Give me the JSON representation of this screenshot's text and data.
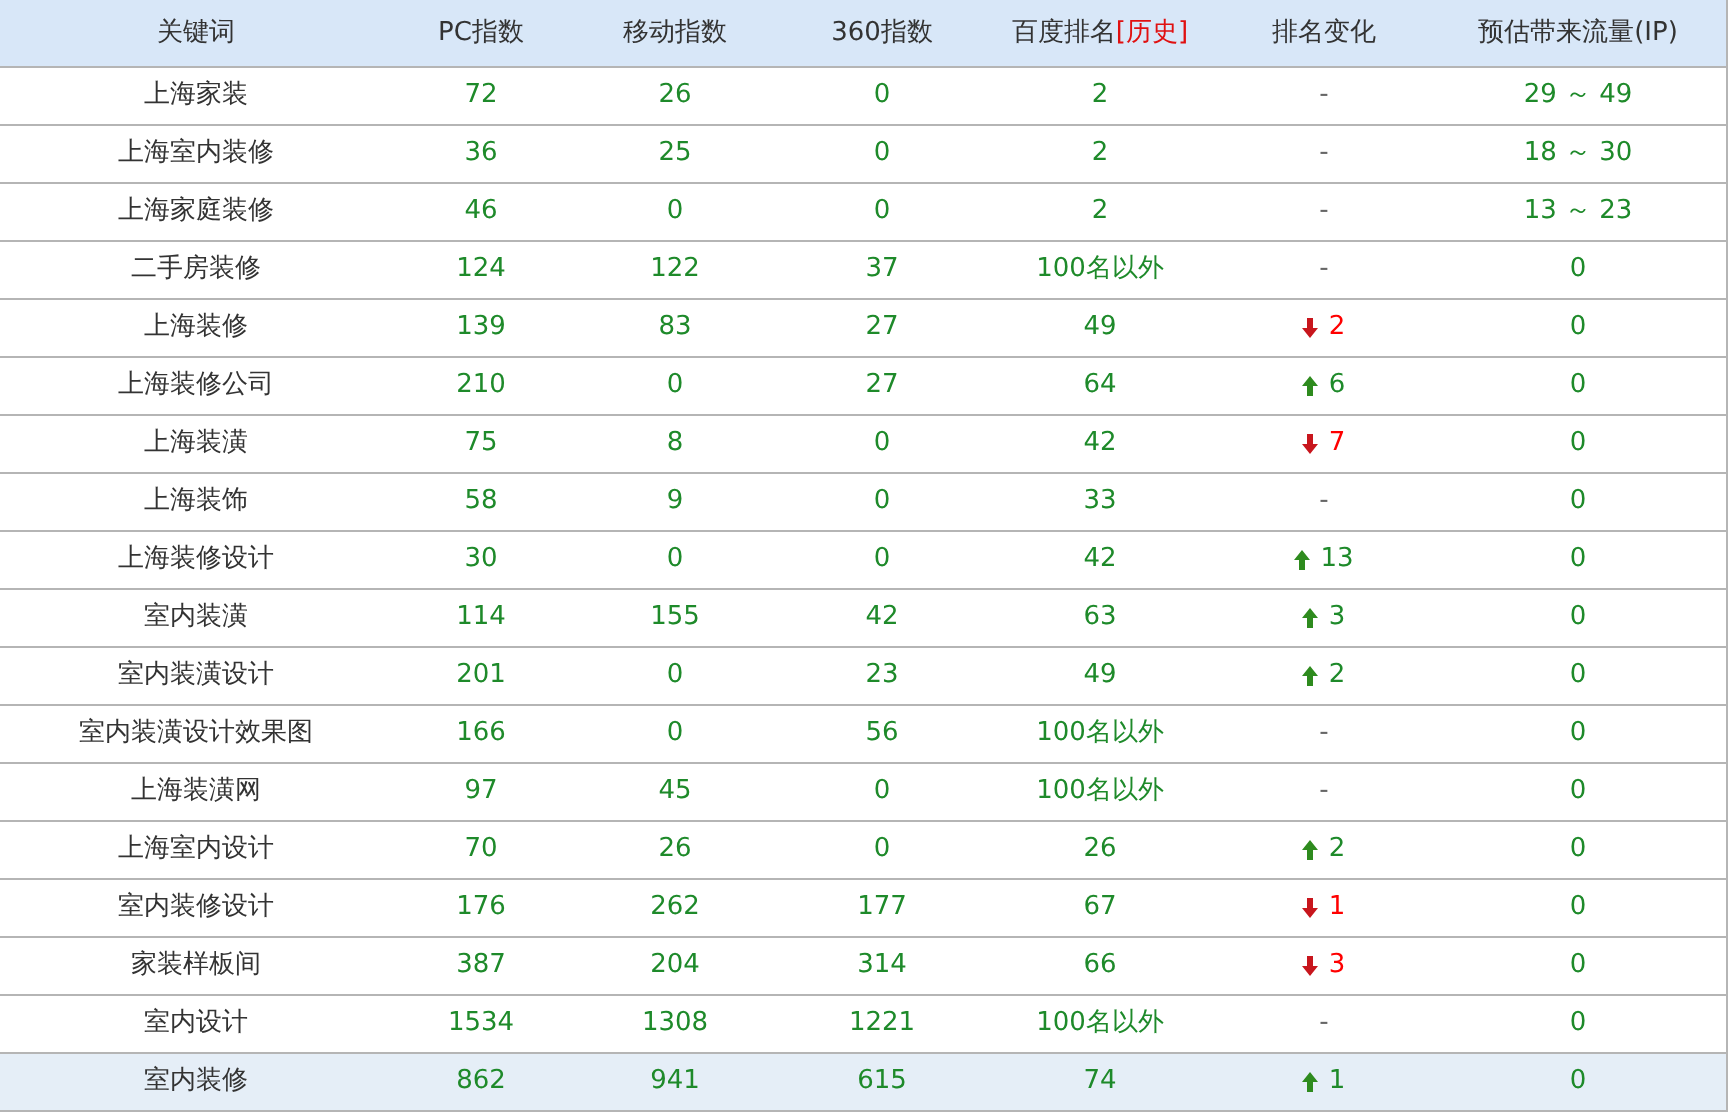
{
  "table": {
    "columns": [
      {
        "label": "关键词"
      },
      {
        "label": "PC指数"
      },
      {
        "label": "移动指数"
      },
      {
        "label": "360指数"
      },
      {
        "label": "百度排名",
        "link": "[历史]"
      },
      {
        "label": "排名变化"
      },
      {
        "label": "预估带来流量(IP)"
      }
    ],
    "rows": [
      {
        "keyword": "上海家装",
        "pc": "72",
        "mobile": "26",
        "index360": "0",
        "rank": "2",
        "change": {
          "kind": "none",
          "text": "-"
        },
        "traffic": "29 ～ 49",
        "selected": false
      },
      {
        "keyword": "上海室内装修",
        "pc": "36",
        "mobile": "25",
        "index360": "0",
        "rank": "2",
        "change": {
          "kind": "none",
          "text": "-"
        },
        "traffic": "18 ～ 30",
        "selected": false
      },
      {
        "keyword": "上海家庭装修",
        "pc": "46",
        "mobile": "0",
        "index360": "0",
        "rank": "2",
        "change": {
          "kind": "none",
          "text": "-"
        },
        "traffic": "13 ～ 23",
        "selected": false
      },
      {
        "keyword": "二手房装修",
        "pc": "124",
        "mobile": "122",
        "index360": "37",
        "rank": "100名以外",
        "change": {
          "kind": "none",
          "text": "-"
        },
        "traffic": "0",
        "selected": false
      },
      {
        "keyword": "上海装修",
        "pc": "139",
        "mobile": "83",
        "index360": "27",
        "rank": "49",
        "change": {
          "kind": "down",
          "text": "2"
        },
        "traffic": "0",
        "selected": false
      },
      {
        "keyword": "上海装修公司",
        "pc": "210",
        "mobile": "0",
        "index360": "27",
        "rank": "64",
        "change": {
          "kind": "up",
          "text": "6"
        },
        "traffic": "0",
        "selected": false
      },
      {
        "keyword": "上海装潢",
        "pc": "75",
        "mobile": "8",
        "index360": "0",
        "rank": "42",
        "change": {
          "kind": "down",
          "text": "7"
        },
        "traffic": "0",
        "selected": false
      },
      {
        "keyword": "上海装饰",
        "pc": "58",
        "mobile": "9",
        "index360": "0",
        "rank": "33",
        "change": {
          "kind": "none",
          "text": "-"
        },
        "traffic": "0",
        "selected": false
      },
      {
        "keyword": "上海装修设计",
        "pc": "30",
        "mobile": "0",
        "index360": "0",
        "rank": "42",
        "change": {
          "kind": "up",
          "text": "13"
        },
        "traffic": "0",
        "selected": false
      },
      {
        "keyword": "室内装潢",
        "pc": "114",
        "mobile": "155",
        "index360": "42",
        "rank": "63",
        "change": {
          "kind": "up",
          "text": "3"
        },
        "traffic": "0",
        "selected": false
      },
      {
        "keyword": "室内装潢设计",
        "pc": "201",
        "mobile": "0",
        "index360": "23",
        "rank": "49",
        "change": {
          "kind": "up",
          "text": "2"
        },
        "traffic": "0",
        "selected": false
      },
      {
        "keyword": "室内装潢设计效果图",
        "pc": "166",
        "mobile": "0",
        "index360": "56",
        "rank": "100名以外",
        "change": {
          "kind": "none",
          "text": "-"
        },
        "traffic": "0",
        "selected": false
      },
      {
        "keyword": "上海装潢网",
        "pc": "97",
        "mobile": "45",
        "index360": "0",
        "rank": "100名以外",
        "change": {
          "kind": "none",
          "text": "-"
        },
        "traffic": "0",
        "selected": false
      },
      {
        "keyword": "上海室内设计",
        "pc": "70",
        "mobile": "26",
        "index360": "0",
        "rank": "26",
        "change": {
          "kind": "up",
          "text": "2"
        },
        "traffic": "0",
        "selected": false
      },
      {
        "keyword": "室内装修设计",
        "pc": "176",
        "mobile": "262",
        "index360": "177",
        "rank": "67",
        "change": {
          "kind": "down",
          "text": "1"
        },
        "traffic": "0",
        "selected": false
      },
      {
        "keyword": "家装样板间",
        "pc": "387",
        "mobile": "204",
        "index360": "314",
        "rank": "66",
        "change": {
          "kind": "down",
          "text": "3"
        },
        "traffic": "0",
        "selected": false
      },
      {
        "keyword": "室内设计",
        "pc": "1534",
        "mobile": "1308",
        "index360": "1221",
        "rank": "100名以外",
        "change": {
          "kind": "none",
          "text": "-"
        },
        "traffic": "0",
        "selected": false
      },
      {
        "keyword": "室内装修",
        "pc": "862",
        "mobile": "941",
        "index360": "615",
        "rank": "74",
        "change": {
          "kind": "up",
          "text": "1"
        },
        "traffic": "0",
        "selected": true
      }
    ]
  }
}
